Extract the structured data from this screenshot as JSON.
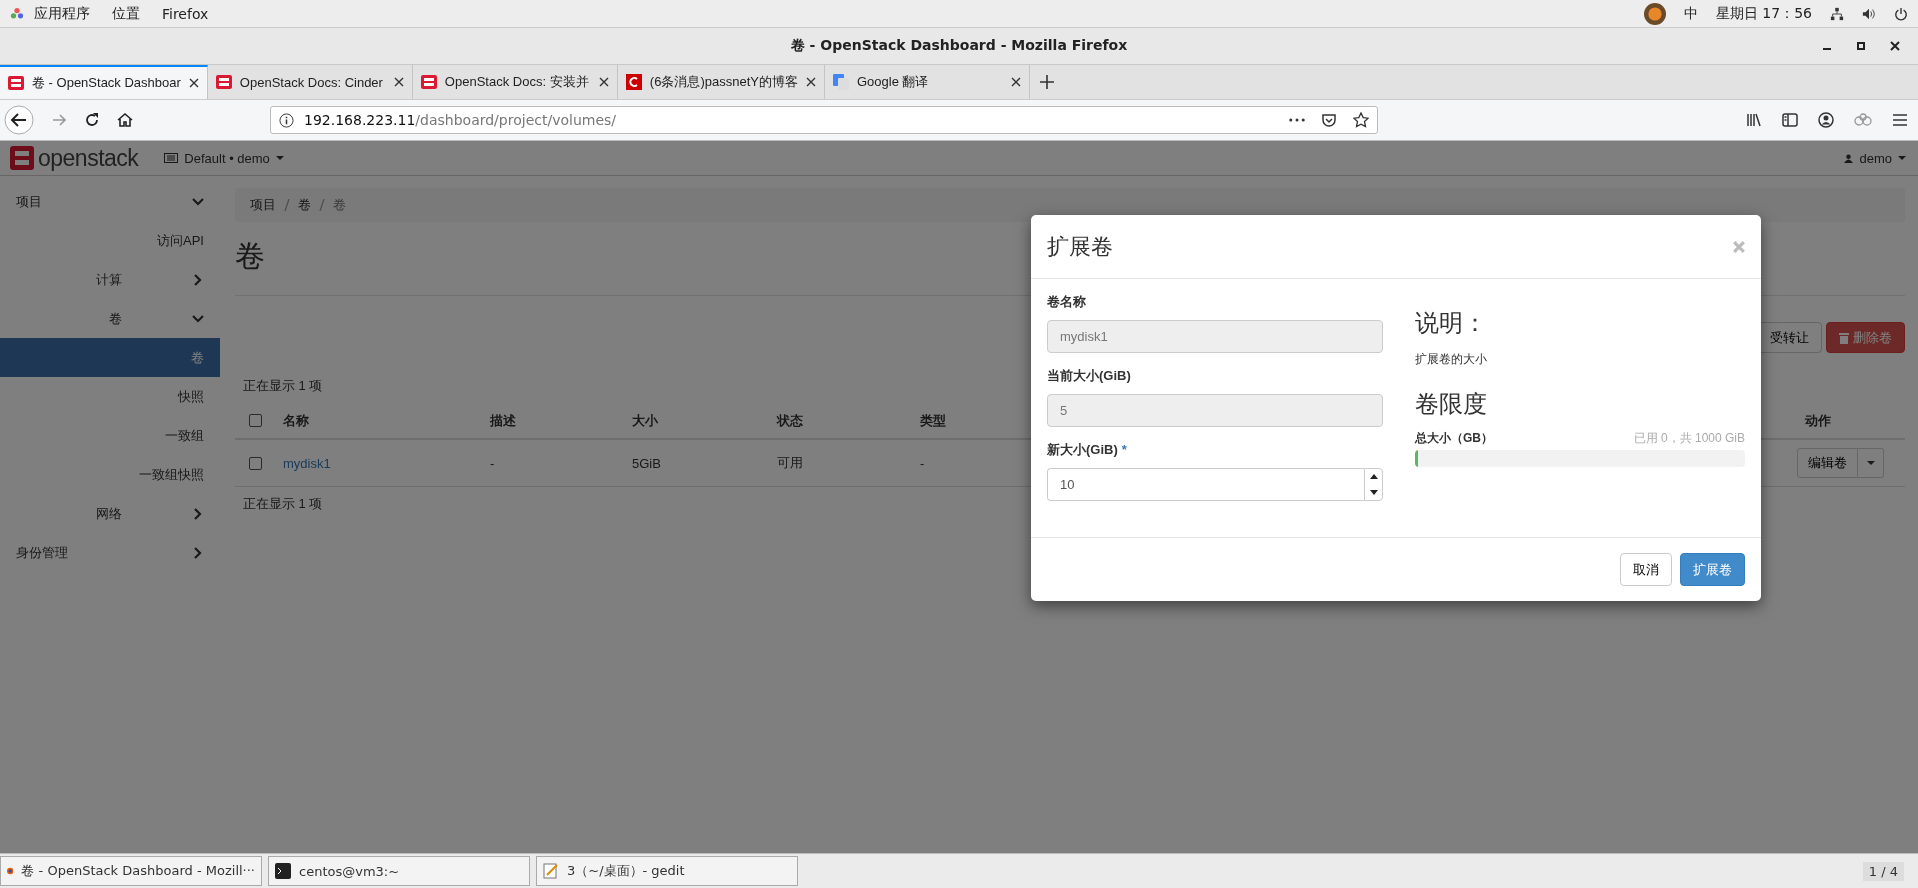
{
  "top_bar": {
    "menus": [
      "应用程序",
      "位置",
      "Firefox"
    ],
    "input_method": "中",
    "clock": "星期日 17：56"
  },
  "window": {
    "title": "卷 - OpenStack Dashboard - Mozilla Firefox"
  },
  "tabs": [
    {
      "label": "卷 - OpenStack Dashboar",
      "selected": true,
      "kind": "openstack"
    },
    {
      "label": "OpenStack Docs: Cinder",
      "selected": false,
      "kind": "openstack"
    },
    {
      "label": "OpenStack Docs: 安装并",
      "selected": false,
      "kind": "openstack"
    },
    {
      "label": "(6条消息)passnetY的博客",
      "selected": false,
      "kind": "csdn"
    },
    {
      "label": "Google 翻译",
      "selected": false,
      "kind": "google"
    }
  ],
  "address": {
    "host": "192.168.223.11",
    "path": "/dashboard/project/volumes/"
  },
  "header": {
    "brand": "openstack",
    "project": "Default • demo",
    "user": "demo"
  },
  "sidebar": [
    {
      "label": "项目",
      "expanded": true,
      "children": [
        {
          "kind": "item",
          "label": "访问API",
          "selected": false
        },
        {
          "kind": "group",
          "label": "计算",
          "expanded": false
        },
        {
          "kind": "group",
          "label": "卷",
          "expanded": true,
          "children": [
            {
              "label": "卷",
              "selected": true
            },
            {
              "label": "快照",
              "selected": false
            },
            {
              "label": "一致组",
              "selected": false
            },
            {
              "label": "一致组快照",
              "selected": false
            }
          ]
        },
        {
          "kind": "group",
          "label": "网络",
          "expanded": false
        }
      ]
    },
    {
      "label": "身份管理",
      "expanded": false
    }
  ],
  "breadcrumb": [
    "项目",
    "卷",
    "卷"
  ],
  "page_title": "卷",
  "toolbar": [
    {
      "label": "受转让",
      "kind": "default"
    },
    {
      "label": "删除卷",
      "kind": "danger"
    }
  ],
  "table": {
    "count_top": "正在显示 1 项",
    "count_bottom": "正在显示 1 项",
    "select_all_checked": false,
    "columns": [
      "名称",
      "描述",
      "大小",
      "状态",
      "类型",
      "动作"
    ],
    "rows": [
      {
        "checked": false,
        "cells": [
          "mydisk1",
          "-",
          "5GiB",
          "可用",
          "-"
        ],
        "action": "编辑卷"
      }
    ]
  },
  "modal": {
    "title": "扩展卷",
    "fields": [
      {
        "label": "卷名称",
        "value": "mydisk1",
        "disabled": true,
        "kind": "text"
      },
      {
        "label": "当前大小(GiB)",
        "value": "5",
        "disabled": true,
        "kind": "text"
      },
      {
        "label": "新大小(GiB)",
        "value": "10",
        "disabled": false,
        "required_mark": "*",
        "kind": "number"
      }
    ],
    "help_title": "说明：",
    "help_text": "扩展卷的大小",
    "limits_title": "卷限度",
    "limit": {
      "label": "总大小（GB）",
      "reading": "已用 0，共 1000 GiB",
      "level": 0.01
    },
    "buttons": [
      {
        "label": "取消",
        "kind": "default"
      },
      {
        "label": "扩展卷",
        "kind": "primary"
      }
    ]
  },
  "taskbar": [
    {
      "label": "卷 - OpenStack Dashboard - Mozill···",
      "kind": "firefox",
      "selected": false
    },
    {
      "label": "centos@vm3:~",
      "kind": "terminal",
      "selected": false
    },
    {
      "label": "3（~/桌面）- gedit",
      "kind": "gedit",
      "selected": false
    }
  ],
  "workspace": "1 / 4"
}
